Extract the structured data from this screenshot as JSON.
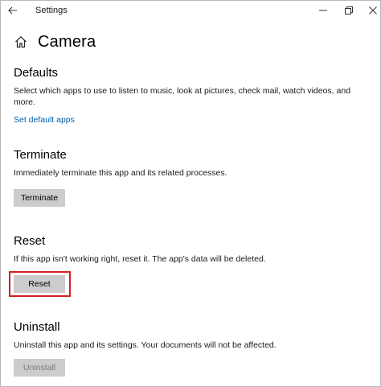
{
  "window": {
    "title": "Settings",
    "back_icon": "arrow-left-icon",
    "controls": [
      "minimize-icon",
      "maximize-icon",
      "close-icon"
    ]
  },
  "page": {
    "title": "Camera",
    "home_icon": "home-icon"
  },
  "defaults": {
    "heading": "Defaults",
    "description": "Select which apps to use to listen to music, look at pictures, check mail, watch videos, and more.",
    "link": "Set default apps"
  },
  "terminate": {
    "heading": "Terminate",
    "description": "Immediately terminate this app and its related processes.",
    "button": "Terminate"
  },
  "reset": {
    "heading": "Reset",
    "description": "If this app isn't working right, reset it. The app's data will be deleted.",
    "button": "Reset"
  },
  "uninstall": {
    "heading": "Uninstall",
    "description": "Uninstall this app and its settings. Your documents will not be affected.",
    "button": "Uninstall",
    "button_disabled": true
  },
  "colors": {
    "link": "#0063b1",
    "button_bg": "#cccccc",
    "highlight": "#d32027"
  }
}
